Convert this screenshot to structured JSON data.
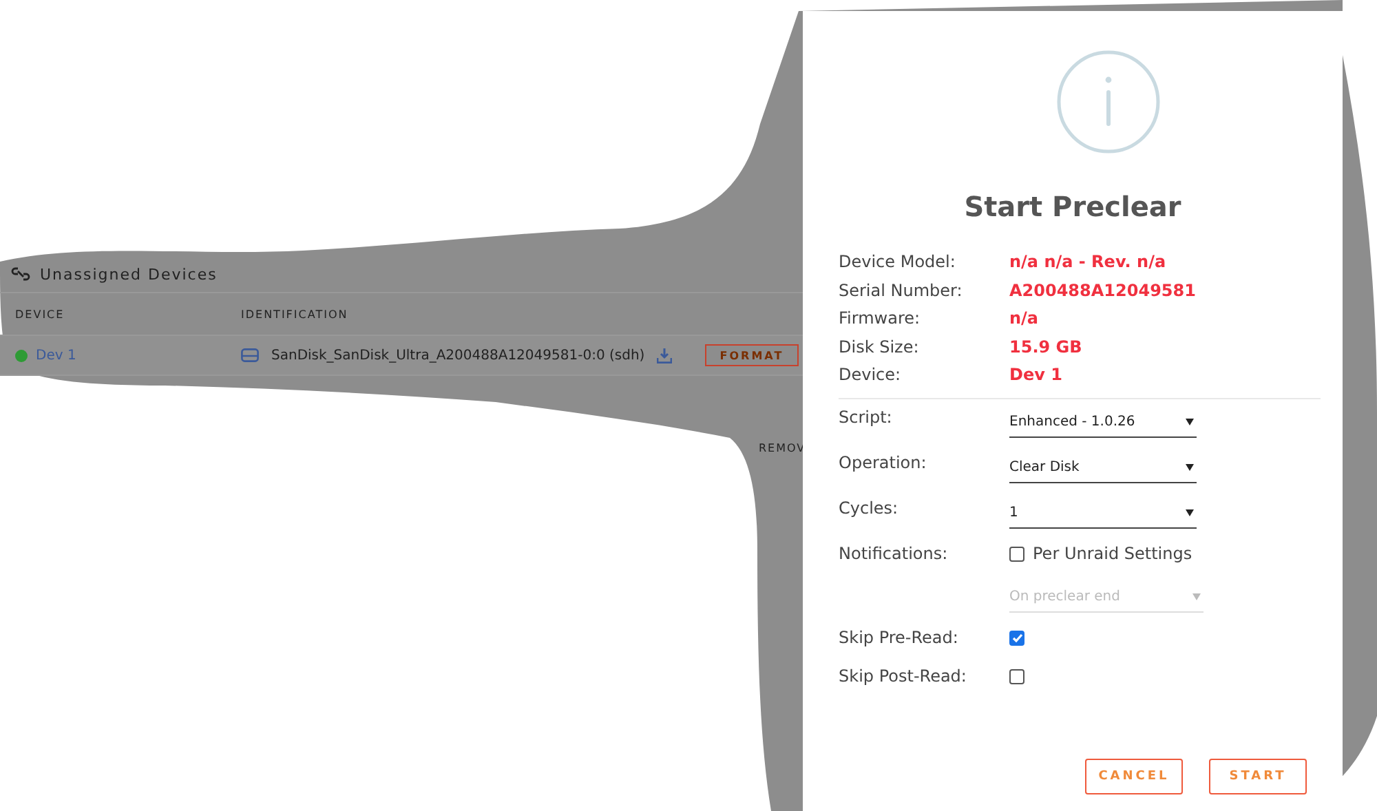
{
  "unassigned_devices": {
    "title": "Unassigned Devices",
    "columns": [
      "DEVICE",
      "IDENTIFICATION"
    ],
    "rows": [
      {
        "device": "Dev 1",
        "color": "#2e9b35",
        "identification": "SanDisk_SanDisk_Ultra_A200488A12049581-0:0 (sdh)",
        "action": "FORMAT"
      }
    ],
    "partial_text": "REMOV"
  },
  "dialog": {
    "title": "Start Preclear",
    "info": [
      {
        "label": "Device Model:",
        "value": "n/a n/a - Rev. n/a"
      },
      {
        "label": "Serial Number:",
        "value": "A200488A12049581"
      },
      {
        "label": "Firmware:",
        "value": "n/a"
      },
      {
        "label": "Disk Size:",
        "value": "15.9 GB"
      },
      {
        "label": "Device:",
        "value": "Dev 1"
      }
    ],
    "settings": [
      {
        "kind": "select",
        "label": "Script:",
        "value": "Enhanced - 1.0.26",
        "disabled": false
      },
      {
        "kind": "select",
        "label": "Operation:",
        "value": "Clear Disk",
        "disabled": false
      },
      {
        "kind": "select",
        "label": "Cycles:",
        "value": "1",
        "disabled": false
      },
      {
        "kind": "checkbox",
        "label": "Notifications:",
        "text": "Per Unraid Settings",
        "checked": false
      },
      {
        "kind": "select",
        "value": "On preclear end",
        "disabled": true
      },
      {
        "kind": "checkbox",
        "label": "Skip Pre-Read:",
        "checked": true
      },
      {
        "kind": "checkbox",
        "label": "Skip Post-Read:",
        "checked": false
      }
    ],
    "buttons": [
      "CANCEL",
      "START"
    ]
  }
}
